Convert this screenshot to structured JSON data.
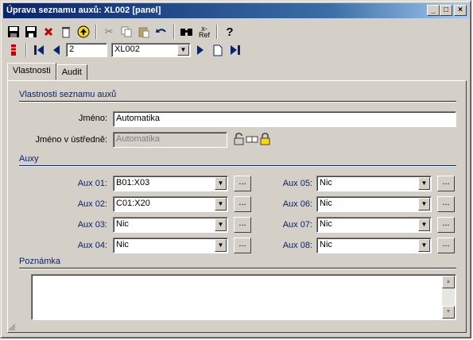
{
  "window": {
    "title": "Úprava seznamu auxů: XL002 [panel]",
    "buttons": [
      "_",
      "□",
      "×"
    ]
  },
  "toolbar1": {
    "icons": [
      "save-icon",
      "save-all-icon",
      "delete-icon",
      "trash-icon",
      "up-icon",
      "cut-icon",
      "copy-icon",
      "paste-icon",
      "undo-icon",
      "find-icon",
      "ref-icon",
      "help-icon"
    ],
    "ref_label_top": "x-",
    "ref_label_bottom": "Ref",
    "help": "?"
  },
  "toolbar2": {
    "record_number": "2",
    "record_combo": "XL002"
  },
  "tabs": [
    {
      "label": "Vlastnosti",
      "active": true
    },
    {
      "label": "Audit",
      "active": false
    }
  ],
  "properties": {
    "heading": "Vlastnosti seznamu auxů",
    "name_label": "Jméno:",
    "name_value": "Automatika",
    "central_label": "Jméno v ústředně:",
    "central_value": "Automatika"
  },
  "auxy": {
    "heading": "Auxy",
    "left": [
      {
        "label": "Aux 01:",
        "value": "B01:X03"
      },
      {
        "label": "Aux 02:",
        "value": "C01:X20"
      },
      {
        "label": "Aux 03:",
        "value": "Nic"
      },
      {
        "label": "Aux 04:",
        "value": "Nic"
      }
    ],
    "right": [
      {
        "label": "Aux 05:",
        "value": "Nic"
      },
      {
        "label": "Aux 06:",
        "value": "Nic"
      },
      {
        "label": "Aux 07:",
        "value": "Nic"
      },
      {
        "label": "Aux 08:",
        "value": "Nic"
      }
    ],
    "dots_label": "..."
  },
  "note": {
    "heading": "Poznámka",
    "value": ""
  },
  "colors": {
    "accent": "#0a246a",
    "face": "#d4d0c8"
  }
}
